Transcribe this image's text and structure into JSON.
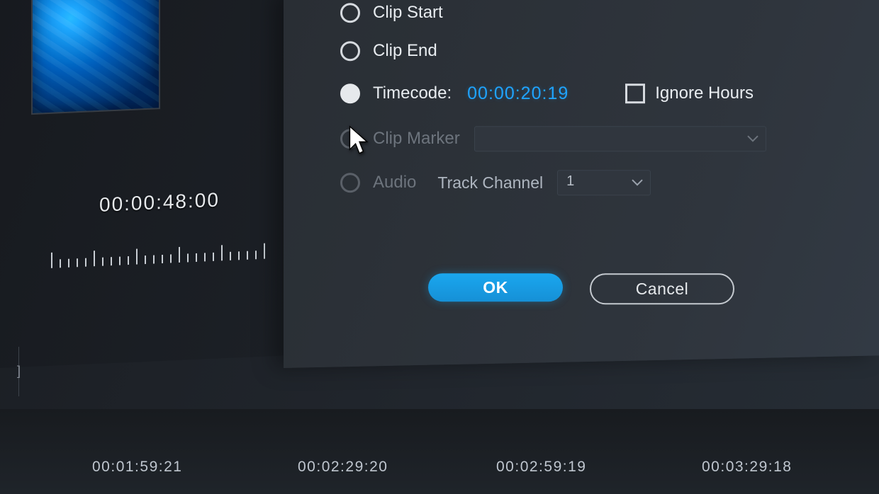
{
  "source": {
    "timecode": "00:00:48:00"
  },
  "dialog": {
    "options": {
      "clip_start": "Clip Start",
      "clip_end": "Clip End",
      "timecode_label": "Timecode:",
      "timecode_value": "00:00:20:19",
      "ignore_hours": "Ignore Hours",
      "clip_marker": "Clip Marker",
      "audio": "Audio",
      "track_channel_label": "Track Channel",
      "track_channel_value": "1"
    },
    "buttons": {
      "ok": "OK",
      "cancel": "Cancel"
    }
  },
  "timeline": {
    "tc1": "00:01:59:21",
    "tc2": "00:02:29:20",
    "tc3": "00:02:59:19",
    "tc4": "00:03:29:18"
  },
  "colors": {
    "accent": "#1aa7ef",
    "link": "#1fa4ff"
  }
}
